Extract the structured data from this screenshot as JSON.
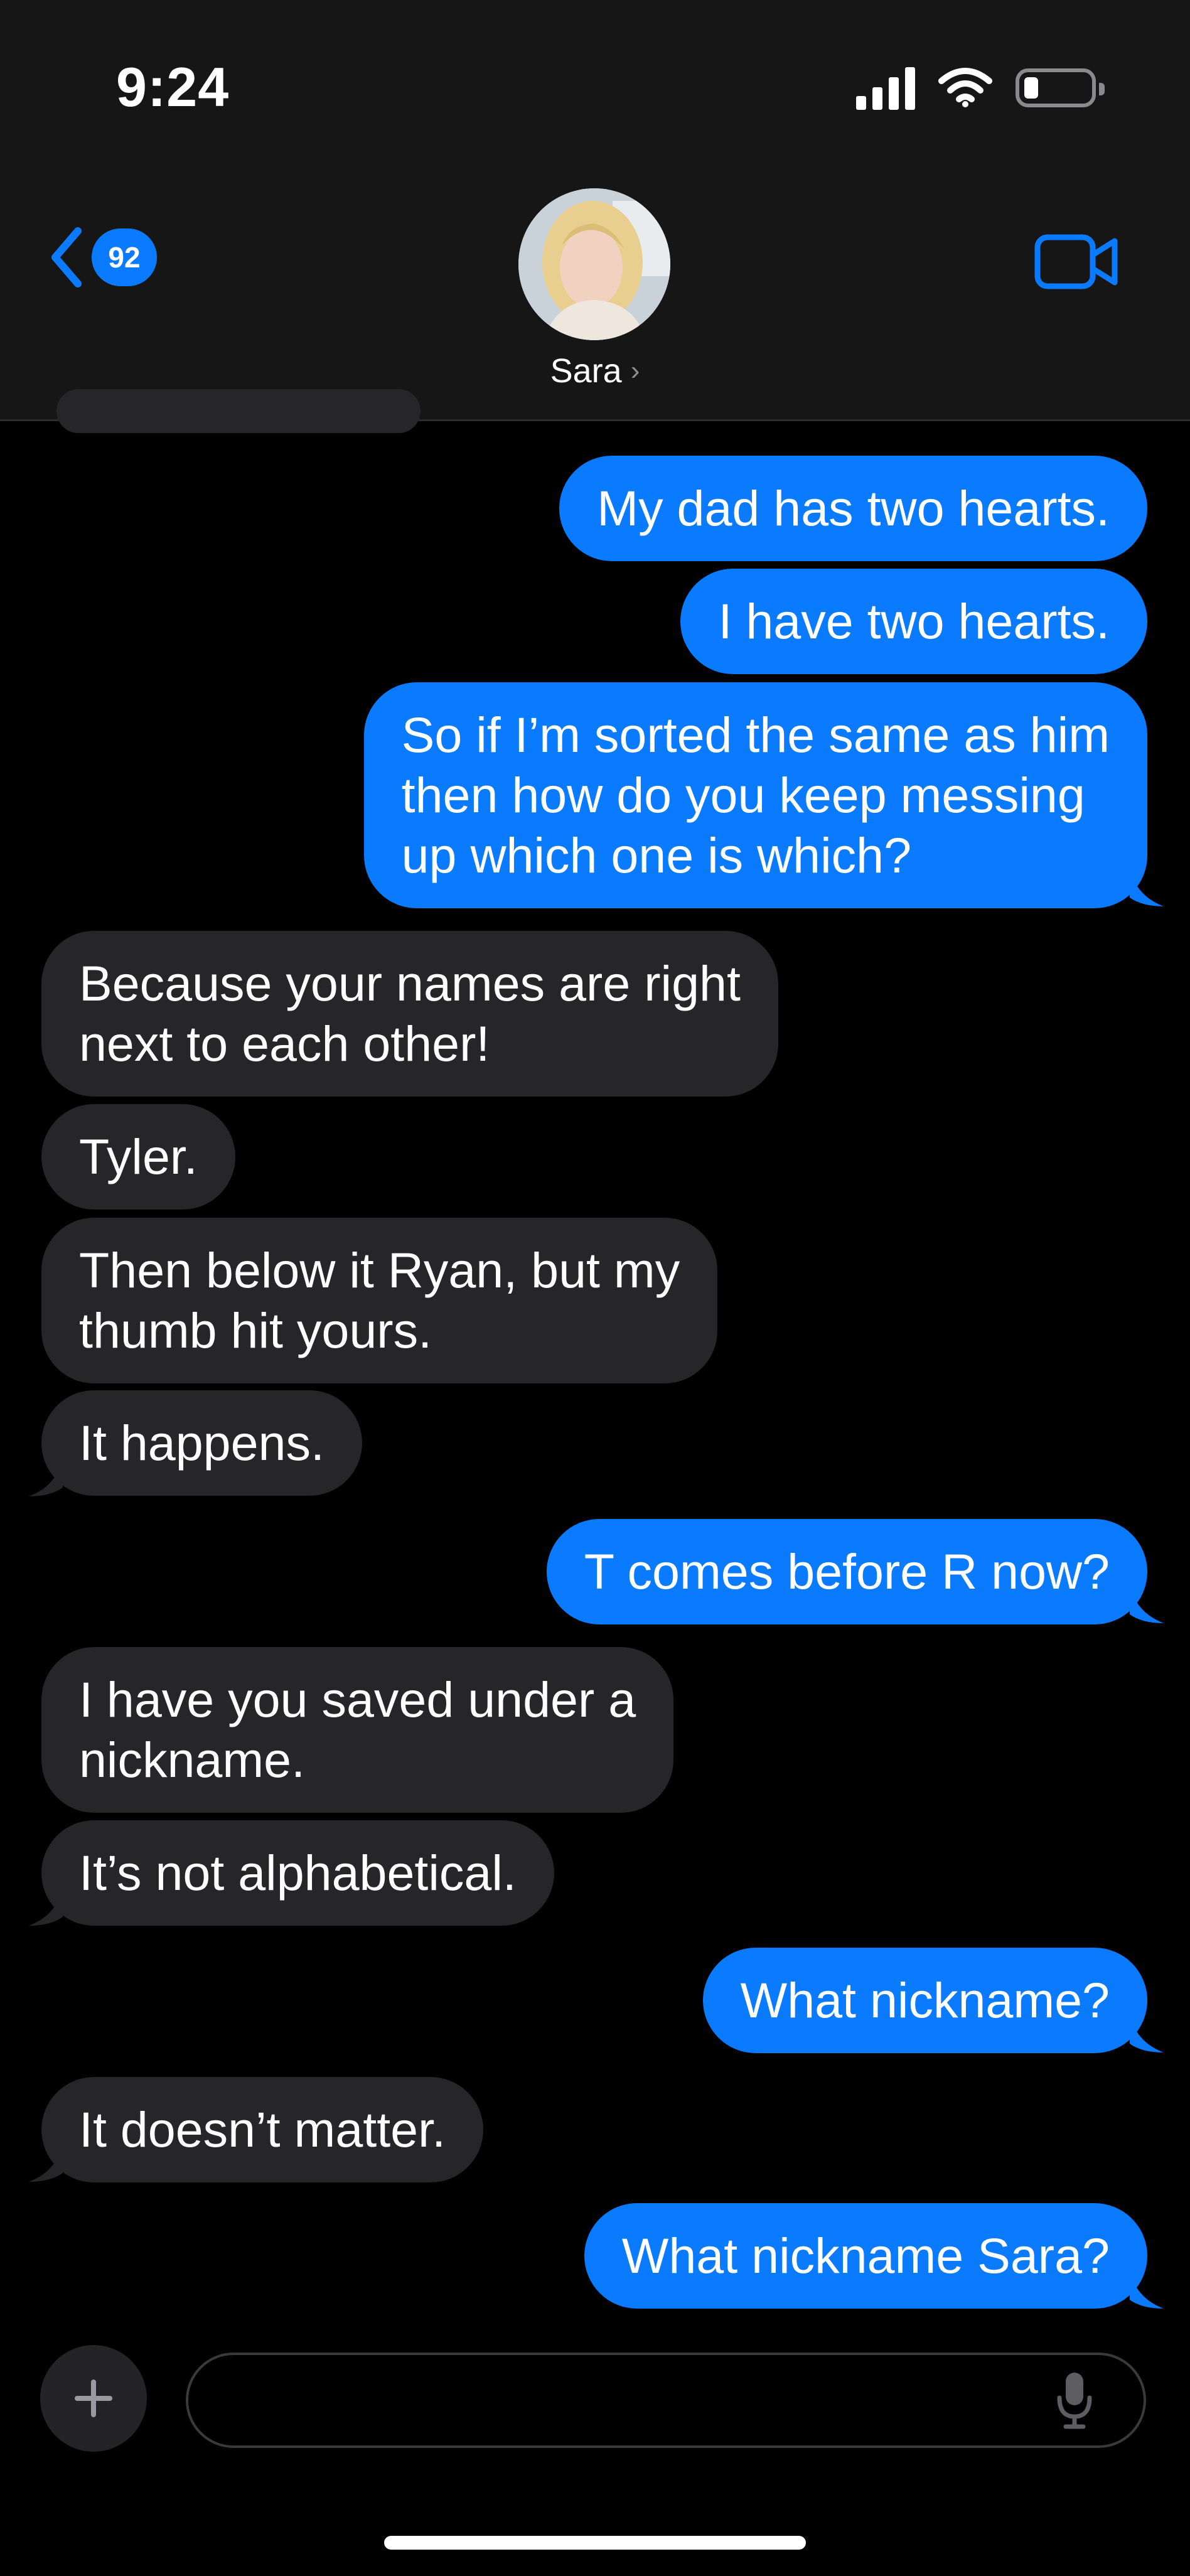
{
  "status_bar": {
    "time": "9:24"
  },
  "nav": {
    "unread_count": "92",
    "contact_name": "Sara"
  },
  "colors": {
    "outgoing": "#0a7bff",
    "incoming": "#262629",
    "background": "#000000"
  },
  "messages": [
    {
      "direction": "outgoing",
      "lines": [
        "My dad has two hearts."
      ]
    },
    {
      "direction": "outgoing",
      "lines": [
        "I have two hearts."
      ]
    },
    {
      "direction": "outgoing",
      "lines": [
        "So if I’m sorted the same as him",
        "then how do you keep messing",
        "up which one is which?"
      ]
    },
    {
      "direction": "incoming",
      "lines": [
        "Because your names are right",
        "next to each other!"
      ]
    },
    {
      "direction": "incoming",
      "lines": [
        "Tyler."
      ]
    },
    {
      "direction": "incoming",
      "lines": [
        "Then below it Ryan, but my",
        "thumb hit yours."
      ]
    },
    {
      "direction": "incoming",
      "lines": [
        "It happens."
      ]
    },
    {
      "direction": "outgoing",
      "lines": [
        "T comes before R now?"
      ]
    },
    {
      "direction": "incoming",
      "lines": [
        "I have you saved under a",
        "nickname."
      ]
    },
    {
      "direction": "incoming",
      "lines": [
        "It’s not alphabetical."
      ]
    },
    {
      "direction": "outgoing",
      "lines": [
        "What nickname?"
      ]
    },
    {
      "direction": "incoming",
      "lines": [
        "It doesn’t matter."
      ]
    },
    {
      "direction": "outgoing",
      "lines": [
        "What nickname Sara?"
      ]
    }
  ],
  "composer": {
    "value": "",
    "placeholder": ""
  },
  "icons": {
    "back": "chevron-left-icon",
    "video": "video-camera-icon",
    "add": "plus-icon",
    "mic": "microphone-icon"
  }
}
